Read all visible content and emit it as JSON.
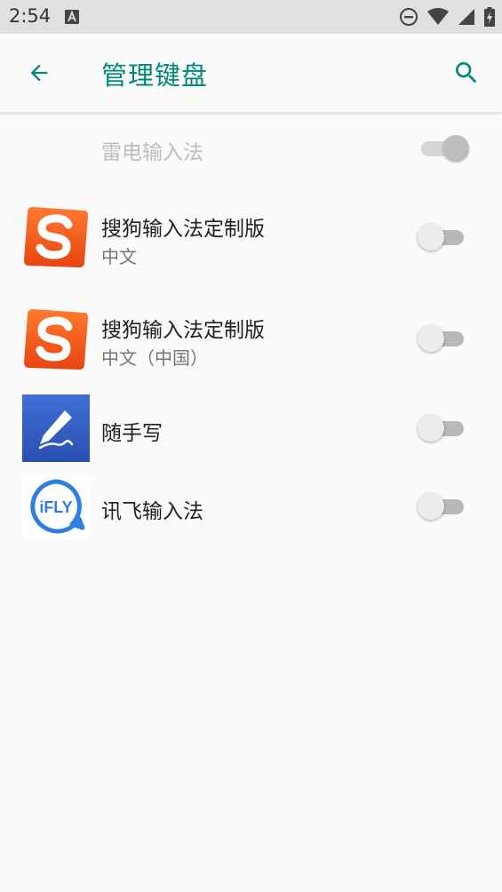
{
  "status_bar": {
    "time": "2:54",
    "icons": [
      "a-notification-icon",
      "do-not-disturb-icon",
      "wifi-icon",
      "cellular-signal-icon",
      "battery-charging-icon"
    ]
  },
  "app_bar": {
    "title": "管理键盘",
    "back_icon": "arrow-back-icon",
    "search_icon": "search-icon",
    "accent_color": "#00897b"
  },
  "keyboards": [
    {
      "title": "雷电输入法",
      "subtitle": "",
      "enabled": true,
      "locked": true
    },
    {
      "title": "搜狗输入法定制版",
      "subtitle": "中文",
      "enabled": false,
      "icon": "sogou-logo-icon"
    },
    {
      "title": "搜狗输入法定制版",
      "subtitle": "中文（中国）",
      "enabled": false,
      "icon": "sogou-logo-icon"
    },
    {
      "title": "随手写",
      "subtitle": "",
      "enabled": false,
      "icon": "handwriting-pen-icon"
    },
    {
      "title": "讯飞输入法",
      "subtitle": "",
      "enabled": false,
      "icon": "ifly-logo-icon",
      "icon_text": "iFLY"
    }
  ]
}
